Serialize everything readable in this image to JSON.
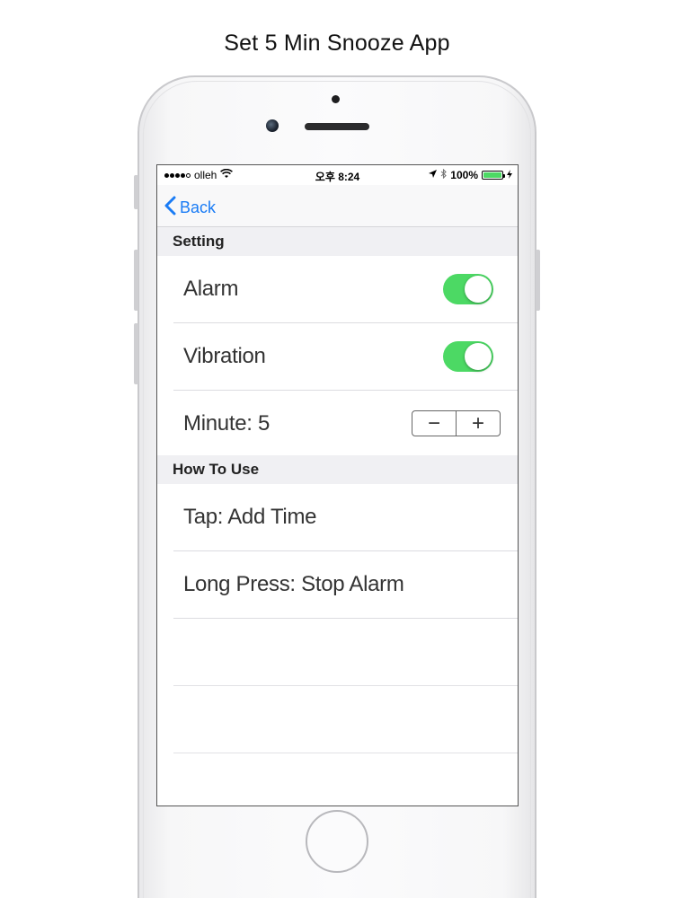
{
  "title": "Set 5 Min Snooze App",
  "status_bar": {
    "carrier": "olleh",
    "time": "오후 8:24",
    "battery": "100%",
    "battery_color": "#4cd964"
  },
  "nav": {
    "back_label": "Back",
    "accent_color": "#1a7cf5"
  },
  "settings": {
    "header": "Setting",
    "alarm_label": "Alarm",
    "alarm_on": true,
    "vibration_label": "Vibration",
    "vibration_on": true,
    "minute_label": "Minute: 5",
    "minus_symbol": "−",
    "plus_symbol": "+"
  },
  "how_to_use": {
    "header": "How To Use",
    "items": [
      "Tap: Add Time",
      "Long Press: Stop Alarm"
    ]
  },
  "colors": {
    "toggle_on": "#4cd964"
  }
}
